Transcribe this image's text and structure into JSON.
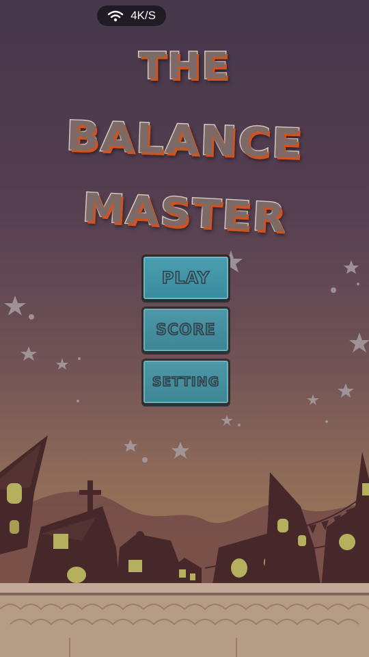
{
  "status": {
    "network_speed": "4K/S",
    "icon": "wifi-icon"
  },
  "game": {
    "title_lines": [
      "THE",
      "BALANCE",
      "MASTER"
    ]
  },
  "menu": {
    "play_label": "PLAY",
    "score_label": "SCORE",
    "setting_label": "SETTING"
  },
  "colors": {
    "sky_top": "#4b3b50",
    "sky_bottom": "#a8815f",
    "button_teal": "#4a9fb0",
    "title_shadow": "#d0521f",
    "house_dark": "#4a2a2c",
    "window_glow": "#c9c466",
    "ground": "#c9ad92"
  }
}
